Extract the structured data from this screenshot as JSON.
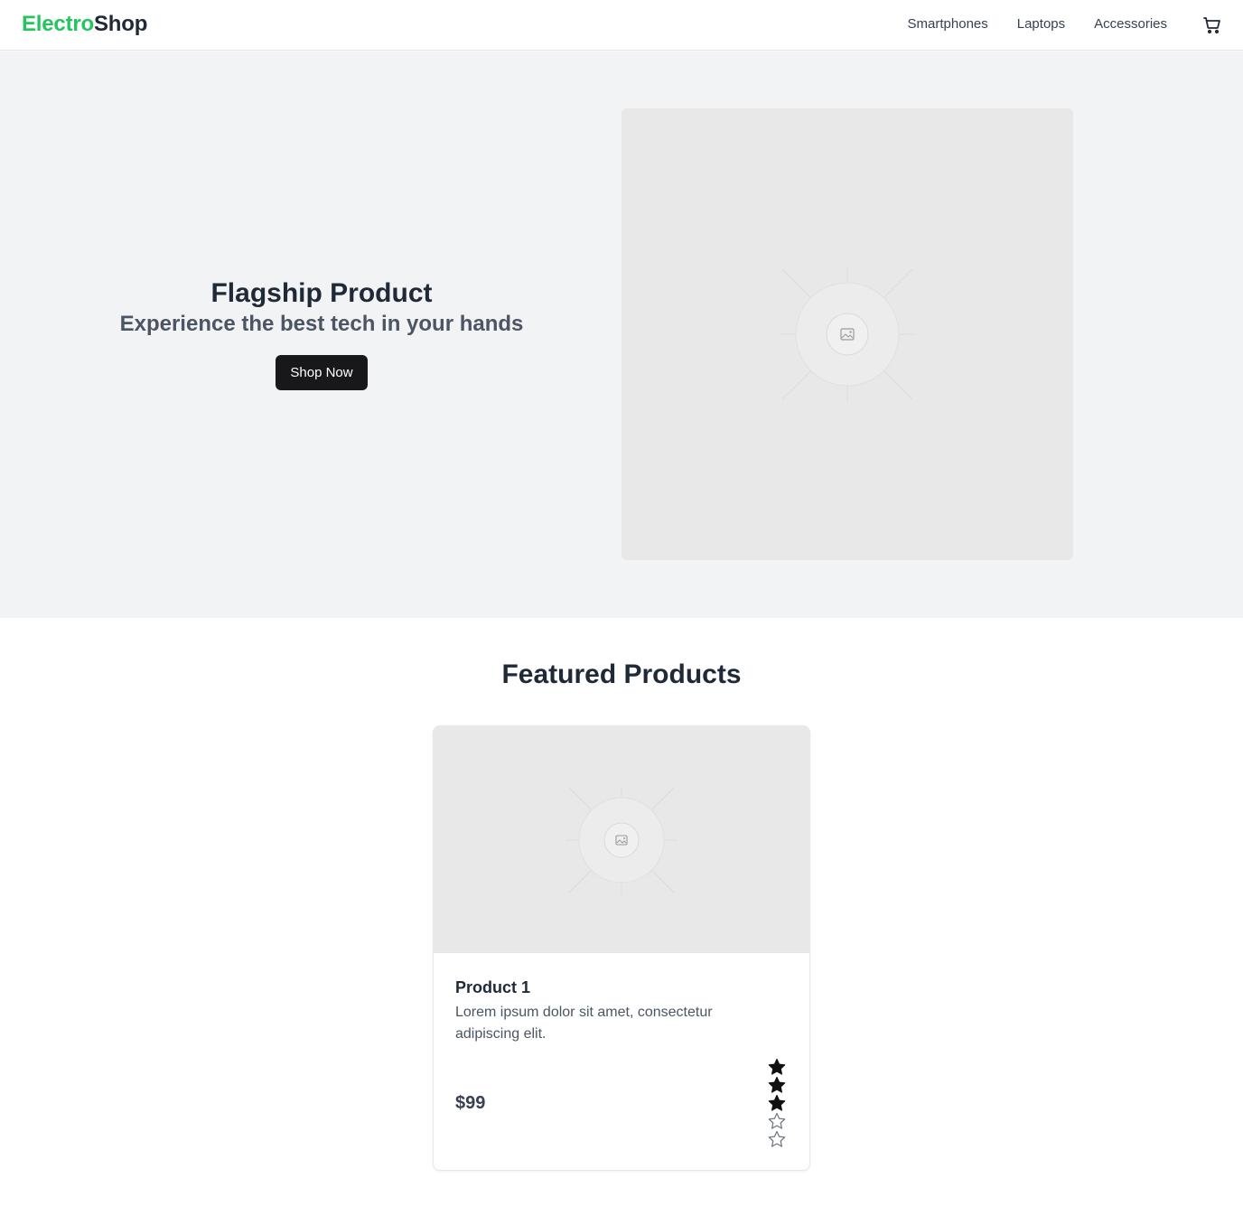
{
  "header": {
    "logo_part1": "Electro",
    "logo_part2": "Shop",
    "brand_color": "#22c55e",
    "nav": [
      {
        "label": "Smartphones"
      },
      {
        "label": "Laptops"
      },
      {
        "label": "Accessories"
      }
    ],
    "cart_icon": "shopping-cart-icon"
  },
  "hero": {
    "title": "Flagship Product",
    "subtitle": "Experience the best tech in your hands",
    "button_label": "Shop Now",
    "image_icon": "image-placeholder-icon"
  },
  "featured": {
    "title": "Featured Products",
    "products": [
      {
        "name": "Product 1",
        "description": "Lorem ipsum dolor sit amet, consectetur adipiscing elit.",
        "price": "$99",
        "rating": 3,
        "rating_max": 5
      }
    ]
  }
}
